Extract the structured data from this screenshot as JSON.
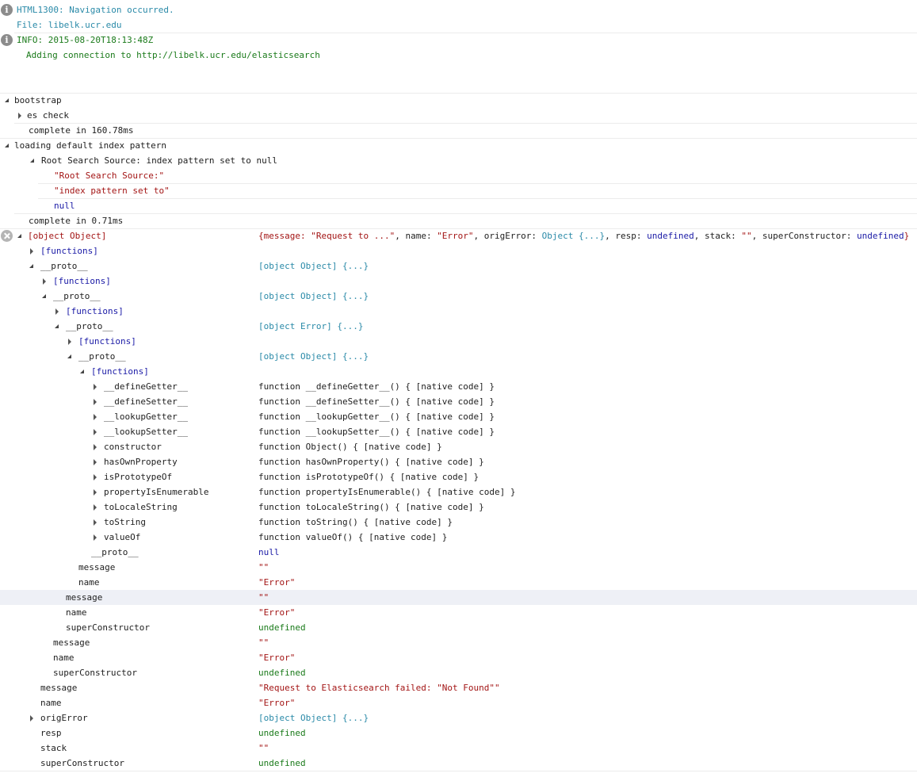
{
  "messages": {
    "nav_code": "HTML1300: Navigation occurred.",
    "nav_file": "File: libelk.ucr.edu",
    "info_time": "INFO: 2015-08-20T18:13:48Z",
    "info_msg": "Adding connection to http://libelk.ucr.edu/elasticsearch"
  },
  "groups": {
    "bootstrap": "bootstrap",
    "es_check": "es check",
    "bootstrap_complete": "complete in 160.78ms",
    "loading": "loading default index pattern",
    "root_search": "Root Search Source: index pattern set to null",
    "root_search_str": "\"Root Search Source:\"",
    "index_pattern_str": "\"index pattern set to\"",
    "null_val": "null",
    "loading_complete": "complete in 0.71ms"
  },
  "error": {
    "label": "[object Object]",
    "summary_open": "{message: ",
    "summary_msg": "\"Request to ...\"",
    "summary_name_key": ", name: ",
    "summary_name": "\"Error\"",
    "summary_orig_key": ", origError: ",
    "summary_orig": "Object {...}",
    "summary_resp_key": ", resp: ",
    "summary_resp": "undefined",
    "summary_stack_key": ", stack: ",
    "summary_stack": "\"\"",
    "summary_sc_key": ", superConstructor: ",
    "summary_sc": "undefined",
    "summary_close": "}"
  },
  "tree": [
    {
      "key": "[functions]",
      "value": ""
    },
    {
      "key": "__proto__",
      "value": "[object Object] {...}"
    },
    {
      "key": "[functions]",
      "value": ""
    },
    {
      "key": "__proto__",
      "value": "[object Object] {...}"
    },
    {
      "key": "[functions]",
      "value": ""
    },
    {
      "key": "__proto__",
      "value": "[object Error] {...}"
    },
    {
      "key": "[functions]",
      "value": ""
    },
    {
      "key": "__proto__",
      "value": "[object Object] {...}"
    },
    {
      "key": "[functions]",
      "value": ""
    },
    {
      "key": "__defineGetter__",
      "value": "function __defineGetter__() { [native code] }"
    },
    {
      "key": "__defineSetter__",
      "value": "function __defineSetter__() { [native code] }"
    },
    {
      "key": "__lookupGetter__",
      "value": "function __lookupGetter__() { [native code] }"
    },
    {
      "key": "__lookupSetter__",
      "value": "function __lookupSetter__() { [native code] }"
    },
    {
      "key": "constructor",
      "value": "function Object() { [native code] }"
    },
    {
      "key": "hasOwnProperty",
      "value": "function hasOwnProperty() { [native code] }"
    },
    {
      "key": "isPrototypeOf",
      "value": "function isPrototypeOf() { [native code] }"
    },
    {
      "key": "propertyIsEnumerable",
      "value": "function propertyIsEnumerable() { [native code] }"
    },
    {
      "key": "toLocaleString",
      "value": "function toLocaleString() { [native code] }"
    },
    {
      "key": "toString",
      "value": "function toString() { [native code] }"
    },
    {
      "key": "valueOf",
      "value": "function valueOf() { [native code] }"
    },
    {
      "key": "__proto__",
      "value": "null"
    },
    {
      "key": "message",
      "value": "\"\""
    },
    {
      "key": "name",
      "value": "\"Error\""
    },
    {
      "key": "message",
      "value": "\"\""
    },
    {
      "key": "name",
      "value": "\"Error\""
    },
    {
      "key": "superConstructor",
      "value": "undefined"
    },
    {
      "key": "message",
      "value": "\"\""
    },
    {
      "key": "name",
      "value": "\"Error\""
    },
    {
      "key": "superConstructor",
      "value": "undefined"
    },
    {
      "key": "message",
      "value": "\"Request to Elasticsearch failed: \"Not Found\"\""
    },
    {
      "key": "name",
      "value": "\"Error\""
    },
    {
      "key": "origError",
      "value": "[object Object] {...}"
    },
    {
      "key": "resp",
      "value": "undefined"
    },
    {
      "key": "stack",
      "value": "\"\""
    },
    {
      "key": "superConstructor",
      "value": "undefined"
    }
  ],
  "colors": {
    "blue": "#1a1aa6",
    "teal": "#2a8aa8",
    "red": "#a31515",
    "green": "#1a7a1a",
    "highlight": "#eef0f6"
  }
}
